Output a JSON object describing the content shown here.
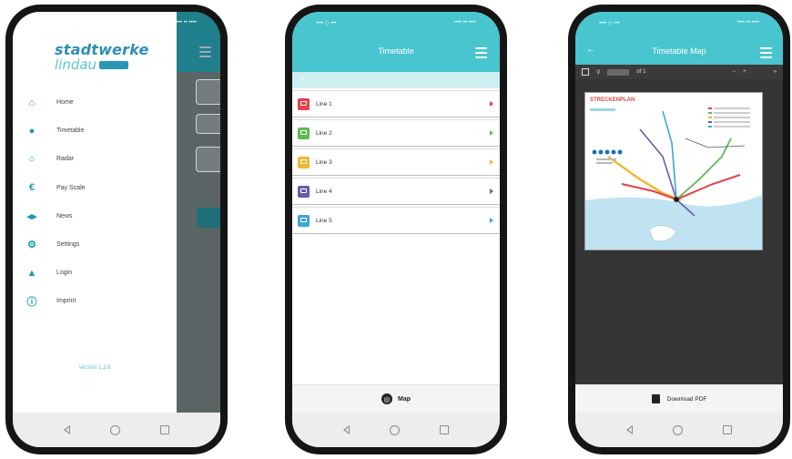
{
  "status": {
    "left": "•••• ◇ •••",
    "right": "•••• •• ••••"
  },
  "phone1": {
    "logo": {
      "line1": "stadtwerke",
      "line2": "lindau"
    },
    "menu": [
      {
        "icon": "home-icon",
        "glyph": "⌂",
        "label": "Home"
      },
      {
        "icon": "timetable-icon",
        "glyph": "●",
        "label": "Timetable"
      },
      {
        "icon": "radar-icon",
        "glyph": "○",
        "label": "Radar"
      },
      {
        "icon": "euro-icon",
        "glyph": "€",
        "label": "Pay Scale"
      },
      {
        "icon": "news-icon",
        "glyph": "◂▸",
        "label": "News"
      },
      {
        "icon": "gear-icon",
        "glyph": "⚙",
        "label": "Settings"
      },
      {
        "icon": "user-icon",
        "glyph": "▲",
        "label": "Login"
      },
      {
        "icon": "info-icon",
        "glyph": "ⓘ",
        "label": "Imprint"
      }
    ],
    "version": "Version 1.2.8"
  },
  "phone2": {
    "title": "Timetable",
    "strip": "•••",
    "lines": [
      {
        "label": "Line 1",
        "color": "#e5414a"
      },
      {
        "label": "Line 2",
        "color": "#5dbb55"
      },
      {
        "label": "Line 3",
        "color": "#f2b632"
      },
      {
        "label": "Line 4",
        "color": "#6a5aa8"
      },
      {
        "label": "Line 5",
        "color": "#3ea6d3"
      }
    ],
    "map_button": "Map"
  },
  "phone3": {
    "title": "Timetable Map",
    "page_count": "of 1",
    "zoom_out": "−",
    "zoom_in": "+",
    "more": "»",
    "map_title": "STRECKENPLAN",
    "download": "Download PDF"
  },
  "colors": {
    "accent": "#49c5cf",
    "drawer_icon": "#1d9bb4",
    "dark_bg": "#353535"
  }
}
